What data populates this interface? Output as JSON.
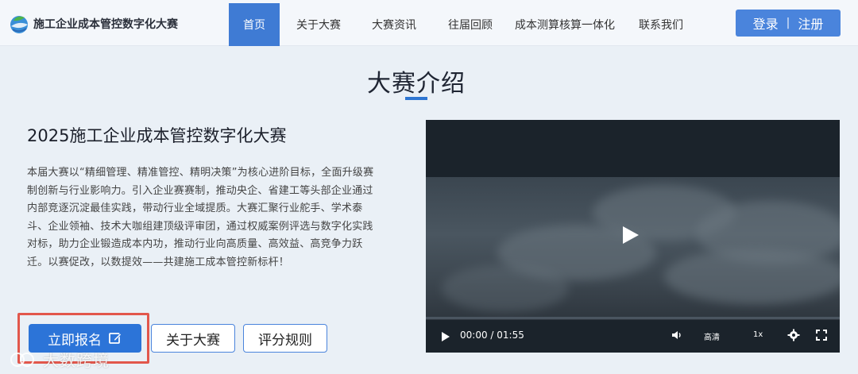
{
  "brand": {
    "name": "施工企业成本管控数字化大赛",
    "logo_icon": "globe-leaf-logo"
  },
  "nav": {
    "items": [
      {
        "label": "首页",
        "active": true
      },
      {
        "label": "关于大赛",
        "active": false
      },
      {
        "label": "大赛资讯",
        "active": false
      },
      {
        "label": "往届回顾",
        "active": false
      },
      {
        "label": "成本测算核算一体化",
        "active": false
      },
      {
        "label": "联系我们",
        "active": false
      }
    ],
    "login_label": "登录",
    "separator": "|",
    "register_label": "注册"
  },
  "section": {
    "title": "大赛介绍"
  },
  "event": {
    "title": "2025施工企业成本管控数字化大赛",
    "description": "本届大赛以“精细管理、精准管控、精明决策”为核心进阶目标，全面升级赛制创新与行业影响力。引入企业赛赛制，推动央企、省建工等头部企业通过内部竞逐沉淀最佳实践，带动行业全域提质。大赛汇聚行业舵手、学术泰斗、企业领袖、技术大咖组建顶级评审团，通过权威案例评选与数字化实践对标，助力企业锻造成本内功，推动行业向高质量、高效益、高竞争力跃迁。以赛促改，以数提效——共建施工成本管控新标杆！"
  },
  "actions": {
    "register_now": "立即报名",
    "about": "关于大赛",
    "rules": "评分规则"
  },
  "video": {
    "time": "00:00 / 01:55",
    "progress": 0,
    "quality": "高清",
    "speed": "1x"
  },
  "watermark": {
    "text": "大数跨境"
  },
  "colors": {
    "primary": "#2c74d8",
    "nav_active": "#3f7bd4",
    "highlight": "#e2574c",
    "background": "#eaf0f6"
  }
}
